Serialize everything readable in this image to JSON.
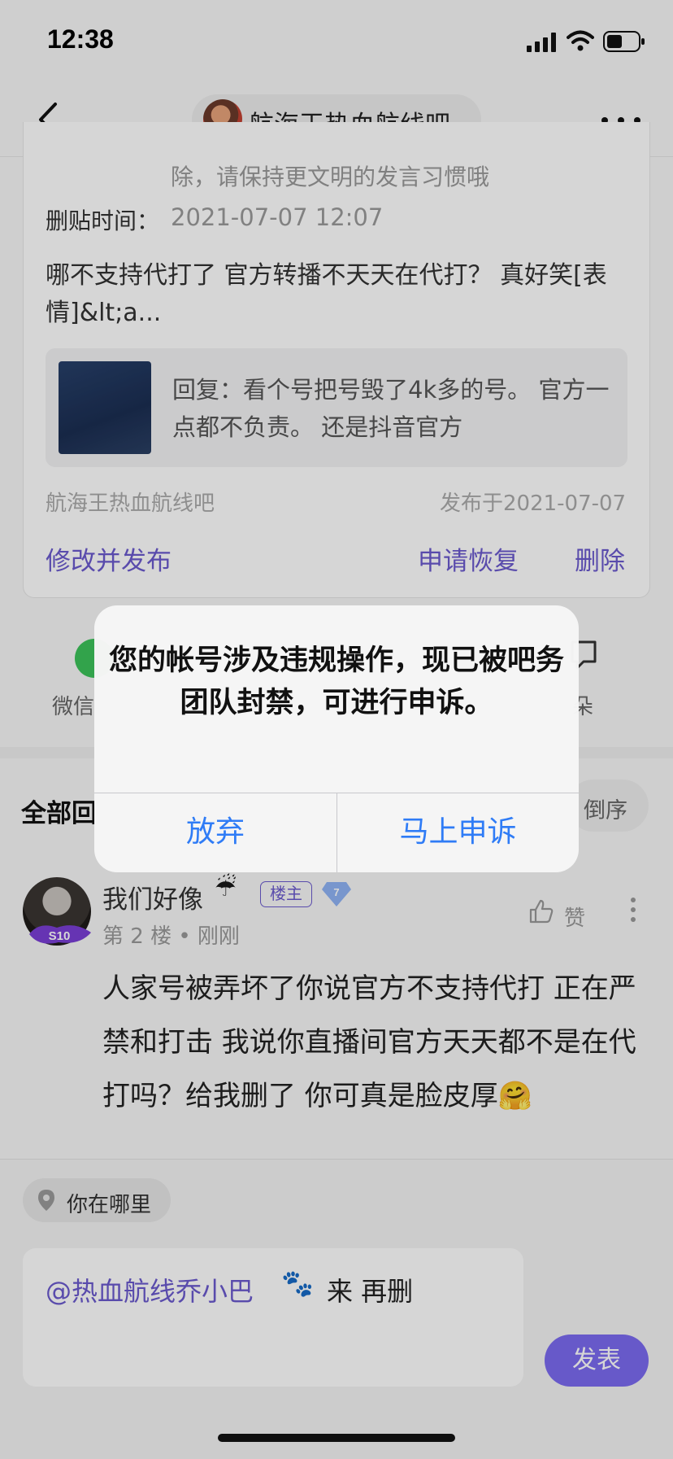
{
  "status_bar": {
    "time": "12:38"
  },
  "nav": {
    "forum_title": "航海王热血航线吧"
  },
  "deleted_post": {
    "note": "除，请保持更文明的发言习惯哦",
    "deleted_time_label": "删贴时间：",
    "deleted_time_value": "2021-07-07 12:07",
    "text": "哪不支持代打了 官方转播不天天在代打？ 真好笑[表情]&lt;a...",
    "quote_text": "回复：看个号把号毁了4k多的号。 官方一点都不负责。 还是抖音官方",
    "forum_name": "航海王热血航线吧",
    "published_date": "发布于2021-07-07",
    "edit_publish_label": "修改并发布",
    "restore_label": "申请恢复",
    "delete_label": "删除"
  },
  "share": {
    "wechat_label": "微信",
    "more_label": "朵"
  },
  "replies_header": {
    "all_label": "全部回",
    "order_label": "倒序"
  },
  "reply": {
    "username": "我们好像",
    "username_emoji": "☔",
    "owner_tag": "楼主",
    "level": "S10",
    "meta": "第 2 楼 • 刚刚",
    "like_label": "赞",
    "text": "人家号被弄坏了你说官方不支持代打 正在严禁和打击 我说你直播间官方天天都不是在代打吗？给我删了 你可真是脸皮厚",
    "text_emoji": "🤗"
  },
  "composer": {
    "location_label": "你在哪里",
    "mention": "@热血航线乔小巴",
    "mention_emoji": "🐾",
    "rest": " 来 再删",
    "send_label": "发表"
  },
  "alert": {
    "message": "您的帐号涉及违规操作，现已被吧务团队封禁，可进行申诉。",
    "abandon_label": "放弃",
    "appeal_label": "马上申诉"
  },
  "colors": {
    "accent": "#6a5acd",
    "ios_blue": "#2f7cf6",
    "send_button": "#7b6bf0"
  }
}
